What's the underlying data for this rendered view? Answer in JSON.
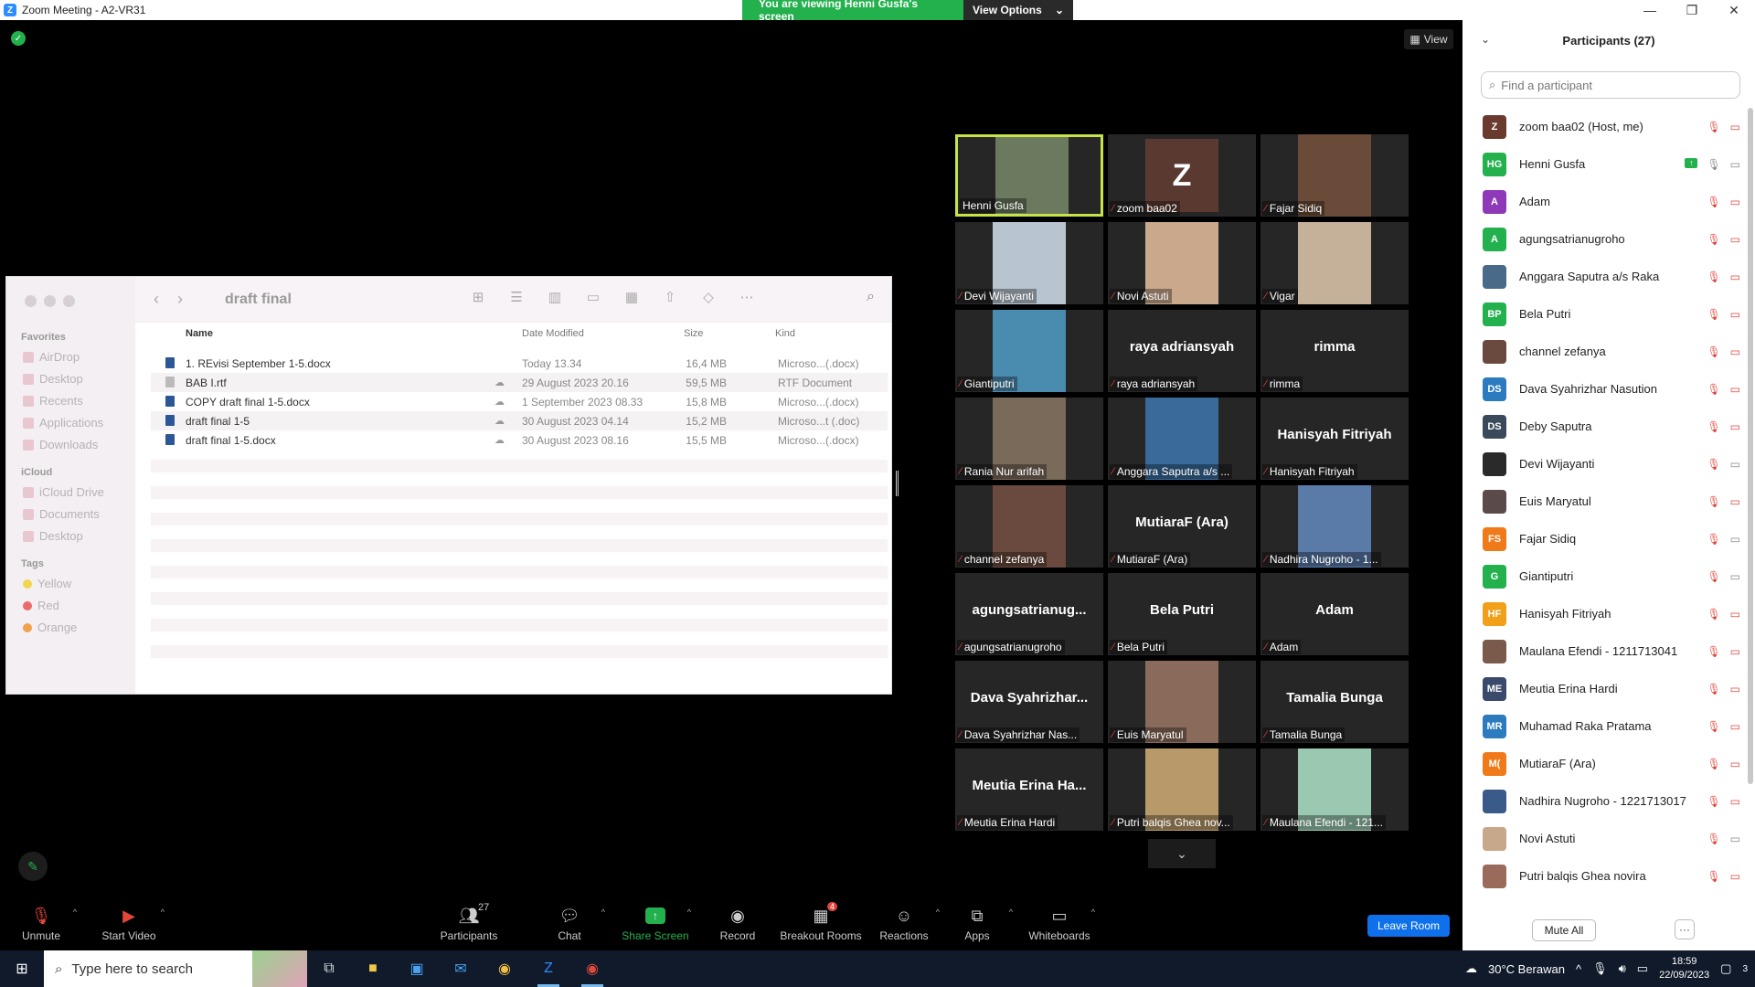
{
  "window": {
    "title": "Zoom Meeting - A2-VR31",
    "share_banner": "You are viewing Henni Gusfa's screen",
    "view_options": "View Options",
    "view_label": "View"
  },
  "finder": {
    "folder_name": "draft final",
    "sidebar": {
      "favorites_label": "Favorites",
      "favorites": [
        "AirDrop",
        "Desktop",
        "Recents",
        "Applications",
        "Downloads"
      ],
      "icloud_label": "iCloud",
      "icloud": [
        "iCloud Drive",
        "Documents",
        "Desktop"
      ],
      "tags_label": "Tags",
      "tags": [
        {
          "name": "Yellow",
          "color": "#f2d44e"
        },
        {
          "name": "Red",
          "color": "#ec6b6b"
        },
        {
          "name": "Orange",
          "color": "#f0a14c"
        }
      ]
    },
    "columns": {
      "name": "Name",
      "date": "Date Modified",
      "size": "Size",
      "kind": "Kind"
    },
    "files": [
      {
        "name": "1. REvisi September  1-5.docx",
        "date": "Today 13.34",
        "size": "16,4 MB",
        "kind": "Microso...(.docx)",
        "type": "doc",
        "cloud": false
      },
      {
        "name": "BAB I.rtf",
        "date": "29 August 2023 20.16",
        "size": "59,5 MB",
        "kind": "RTF Document",
        "type": "rtf",
        "cloud": true
      },
      {
        "name": "COPY draft final 1-5.docx",
        "date": "1 September 2023 08.33",
        "size": "15,8 MB",
        "kind": "Microso...(.docx)",
        "type": "doc",
        "cloud": true
      },
      {
        "name": "draft final 1-5",
        "date": "30 August 2023 04.14",
        "size": "15,2 MB",
        "kind": "Microso...t (.doc)",
        "type": "doc",
        "cloud": true
      },
      {
        "name": "draft final 1-5.docx",
        "date": "30 August 2023 08.16",
        "size": "15,5 MB",
        "kind": "Microso...(.docx)",
        "type": "doc",
        "cloud": true
      }
    ]
  },
  "tiles": [
    {
      "label": "Henni Gusfa",
      "kind": "photo",
      "color": "#6b7a5e",
      "muted": false,
      "active": true
    },
    {
      "label": "zoom baa02",
      "kind": "avatar",
      "initial": "Z",
      "muted": true
    },
    {
      "label": "Fajar Sidiq",
      "kind": "photo",
      "color": "#6a4a38",
      "muted": true
    },
    {
      "label": "Devi Wijayanti",
      "kind": "photo",
      "color": "#b8c4cf",
      "muted": true
    },
    {
      "label": "Novi Astuti",
      "kind": "photo",
      "color": "#c9a88c",
      "muted": true
    },
    {
      "label": "Vigar",
      "kind": "photo",
      "color": "#c5b09a",
      "muted": true
    },
    {
      "label": "Giantiputri",
      "kind": "photo",
      "color": "#4a8cb0",
      "muted": true
    },
    {
      "label": "raya adriansyah",
      "kind": "name",
      "big": "raya adriansyah",
      "muted": true
    },
    {
      "label": "rimma",
      "kind": "name",
      "big": "rimma",
      "muted": true
    },
    {
      "label": "Rania Nur arifah",
      "kind": "photo",
      "color": "#7a6a5a",
      "muted": true
    },
    {
      "label": "Anggara Saputra a/s ...",
      "kind": "photo",
      "color": "#3a6a9a",
      "muted": true
    },
    {
      "label": "Hanisyah Fitriyah",
      "kind": "name",
      "big": "Hanisyah Fitriyah",
      "muted": true
    },
    {
      "label": "channel zefanya",
      "kind": "photo",
      "color": "#6a4a3e",
      "muted": true
    },
    {
      "label": "MutiaraF (Ara)",
      "kind": "name",
      "big": "MutiaraF (Ara)",
      "muted": true
    },
    {
      "label": "Nadhira Nugroho - 1...",
      "kind": "photo",
      "color": "#5a7aa8",
      "muted": true
    },
    {
      "label": "agungsatrianugroho",
      "kind": "name",
      "big": "agungsatrianug...",
      "muted": true
    },
    {
      "label": "Bela Putri",
      "kind": "name",
      "big": "Bela Putri",
      "muted": true
    },
    {
      "label": "Adam",
      "kind": "name",
      "big": "Adam",
      "muted": true
    },
    {
      "label": "Dava Syahrizhar Nas...",
      "kind": "name",
      "big": "Dava  Syahrizhar...",
      "muted": true
    },
    {
      "label": "Euis Maryatul",
      "kind": "photo",
      "color": "#8a6a5a",
      "muted": true
    },
    {
      "label": "Tamalia Bunga",
      "kind": "name",
      "big": "Tamalia Bunga",
      "muted": true
    },
    {
      "label": "Meutia Erina Hardi",
      "kind": "name",
      "big": "Meutia  Erina  Ha...",
      "muted": true
    },
    {
      "label": "Putri balqis Ghea nov...",
      "kind": "photo",
      "color": "#b89a6a",
      "muted": true
    },
    {
      "label": "Maulana Efendi - 121...",
      "kind": "photo",
      "color": "#9ac8b0",
      "muted": true
    }
  ],
  "participants_panel": {
    "title": "Participants (27)",
    "search_placeholder": "Find a participant",
    "mute_all": "Mute All",
    "more": "···",
    "list": [
      {
        "initials": "Z",
        "color": "#6b3a2e",
        "name": "zoom baa02 (Host, me)",
        "video": false
      },
      {
        "initials": "HG",
        "color": "#23B14D",
        "name": "Henni Gusfa",
        "video": true,
        "sharing": true
      },
      {
        "initials": "A",
        "color": "#8e3ab8",
        "name": "Adam",
        "video": false
      },
      {
        "initials": "A",
        "color": "#23B14D",
        "name": "agungsatrianugroho",
        "video": false
      },
      {
        "initials": "",
        "color": "#4a6a8a",
        "name": "Anggara Saputra a/s Raka",
        "video": false
      },
      {
        "initials": "BP",
        "color": "#23B14D",
        "name": "Bela Putri",
        "video": false
      },
      {
        "initials": "",
        "color": "#6a4a3e",
        "name": "channel zefanya",
        "video": false
      },
      {
        "initials": "DS",
        "color": "#2d7bbf",
        "name": "Dava Syahrizhar Nasution",
        "video": false
      },
      {
        "initials": "DS",
        "color": "#3a4a5a",
        "name": "Deby Saputra",
        "video": false
      },
      {
        "initials": "",
        "color": "#2a2a2a",
        "name": "Devi Wijayanti",
        "video": true
      },
      {
        "initials": "",
        "color": "#5a4a4a",
        "name": "Euis Maryatul",
        "video": false
      },
      {
        "initials": "FS",
        "color": "#f07a1a",
        "name": "Fajar Sidiq",
        "video": true
      },
      {
        "initials": "G",
        "color": "#23B14D",
        "name": "Giantiputri",
        "video": true
      },
      {
        "initials": "HF",
        "color": "#f0a01a",
        "name": "Hanisyah Fitriyah",
        "video": false
      },
      {
        "initials": "",
        "color": "#7a5a4a",
        "name": "Maulana Efendi - 1211713041",
        "video": false
      },
      {
        "initials": "ME",
        "color": "#3a4a6a",
        "name": "Meutia Erina Hardi",
        "video": false
      },
      {
        "initials": "MR",
        "color": "#2d7bbf",
        "name": "Muhamad Raka Pratama",
        "video": false
      },
      {
        "initials": "M(",
        "color": "#f07a1a",
        "name": "MutiaraF (Ara)",
        "video": false
      },
      {
        "initials": "",
        "color": "#3a5a8a",
        "name": "Nadhira Nugroho - 1221713017",
        "video": false
      },
      {
        "initials": "",
        "color": "#c8a88a",
        "name": "Novi Astuti",
        "video": true
      },
      {
        "initials": "",
        "color": "#9a6a5a",
        "name": "Putri balqis Ghea novira",
        "video": false
      }
    ]
  },
  "toolbar": {
    "unmute": "Unmute",
    "start_video": "Start Video",
    "participants": "Participants",
    "participants_count": "27",
    "chat": "Chat",
    "share_screen": "Share Screen",
    "record": "Record",
    "breakout_rooms": "Breakout Rooms",
    "breakout_badge": "4",
    "reactions": "Reactions",
    "apps": "Apps",
    "whiteboards": "Whiteboards",
    "leave_room": "Leave Room"
  },
  "taskbar": {
    "search_placeholder": "Type here to search",
    "weather": "30°C  Berawan",
    "time": "18:59",
    "date": "22/09/2023",
    "notif_count": "3"
  }
}
